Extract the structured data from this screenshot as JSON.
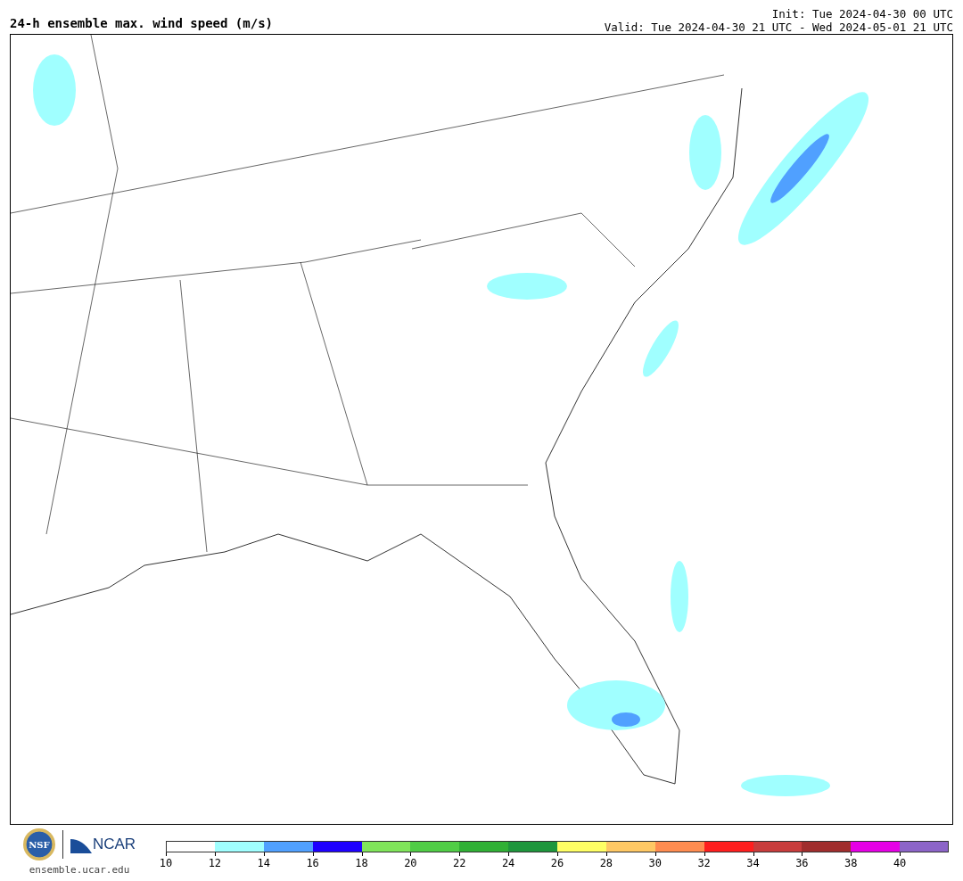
{
  "header": {
    "title": "24-h ensemble max. wind speed (m/s)",
    "init": "Init: Tue 2024-04-30 00 UTC",
    "valid": "Valid: Tue 2024-04-30 21 UTC - Wed 2024-05-01 21 UTC"
  },
  "footer": {
    "seal": "NSF",
    "org": "NCAR",
    "url": "ensemble.ucar.edu"
  },
  "colorbar": [
    {
      "label": "10",
      "color": "#ffffff"
    },
    {
      "label": "12",
      "color": "#a0ffff"
    },
    {
      "label": "14",
      "color": "#50a0ff"
    },
    {
      "label": "16",
      "color": "#1e00ff"
    },
    {
      "label": "18",
      "color": "#80e55a"
    },
    {
      "label": "20",
      "color": "#50cd46"
    },
    {
      "label": "22",
      "color": "#30b035"
    },
    {
      "label": "24",
      "color": "#1e963c"
    },
    {
      "label": "26",
      "color": "#ffff64"
    },
    {
      "label": "28",
      "color": "#ffc864"
    },
    {
      "label": "30",
      "color": "#ff8c50"
    },
    {
      "label": "32",
      "color": "#ff1e1e"
    },
    {
      "label": "34",
      "color": "#c83c3c"
    },
    {
      "label": "36",
      "color": "#a02d2d"
    },
    {
      "label": "38",
      "color": "#e600e6"
    },
    {
      "label": "40",
      "color": "#8c64c8"
    }
  ]
}
